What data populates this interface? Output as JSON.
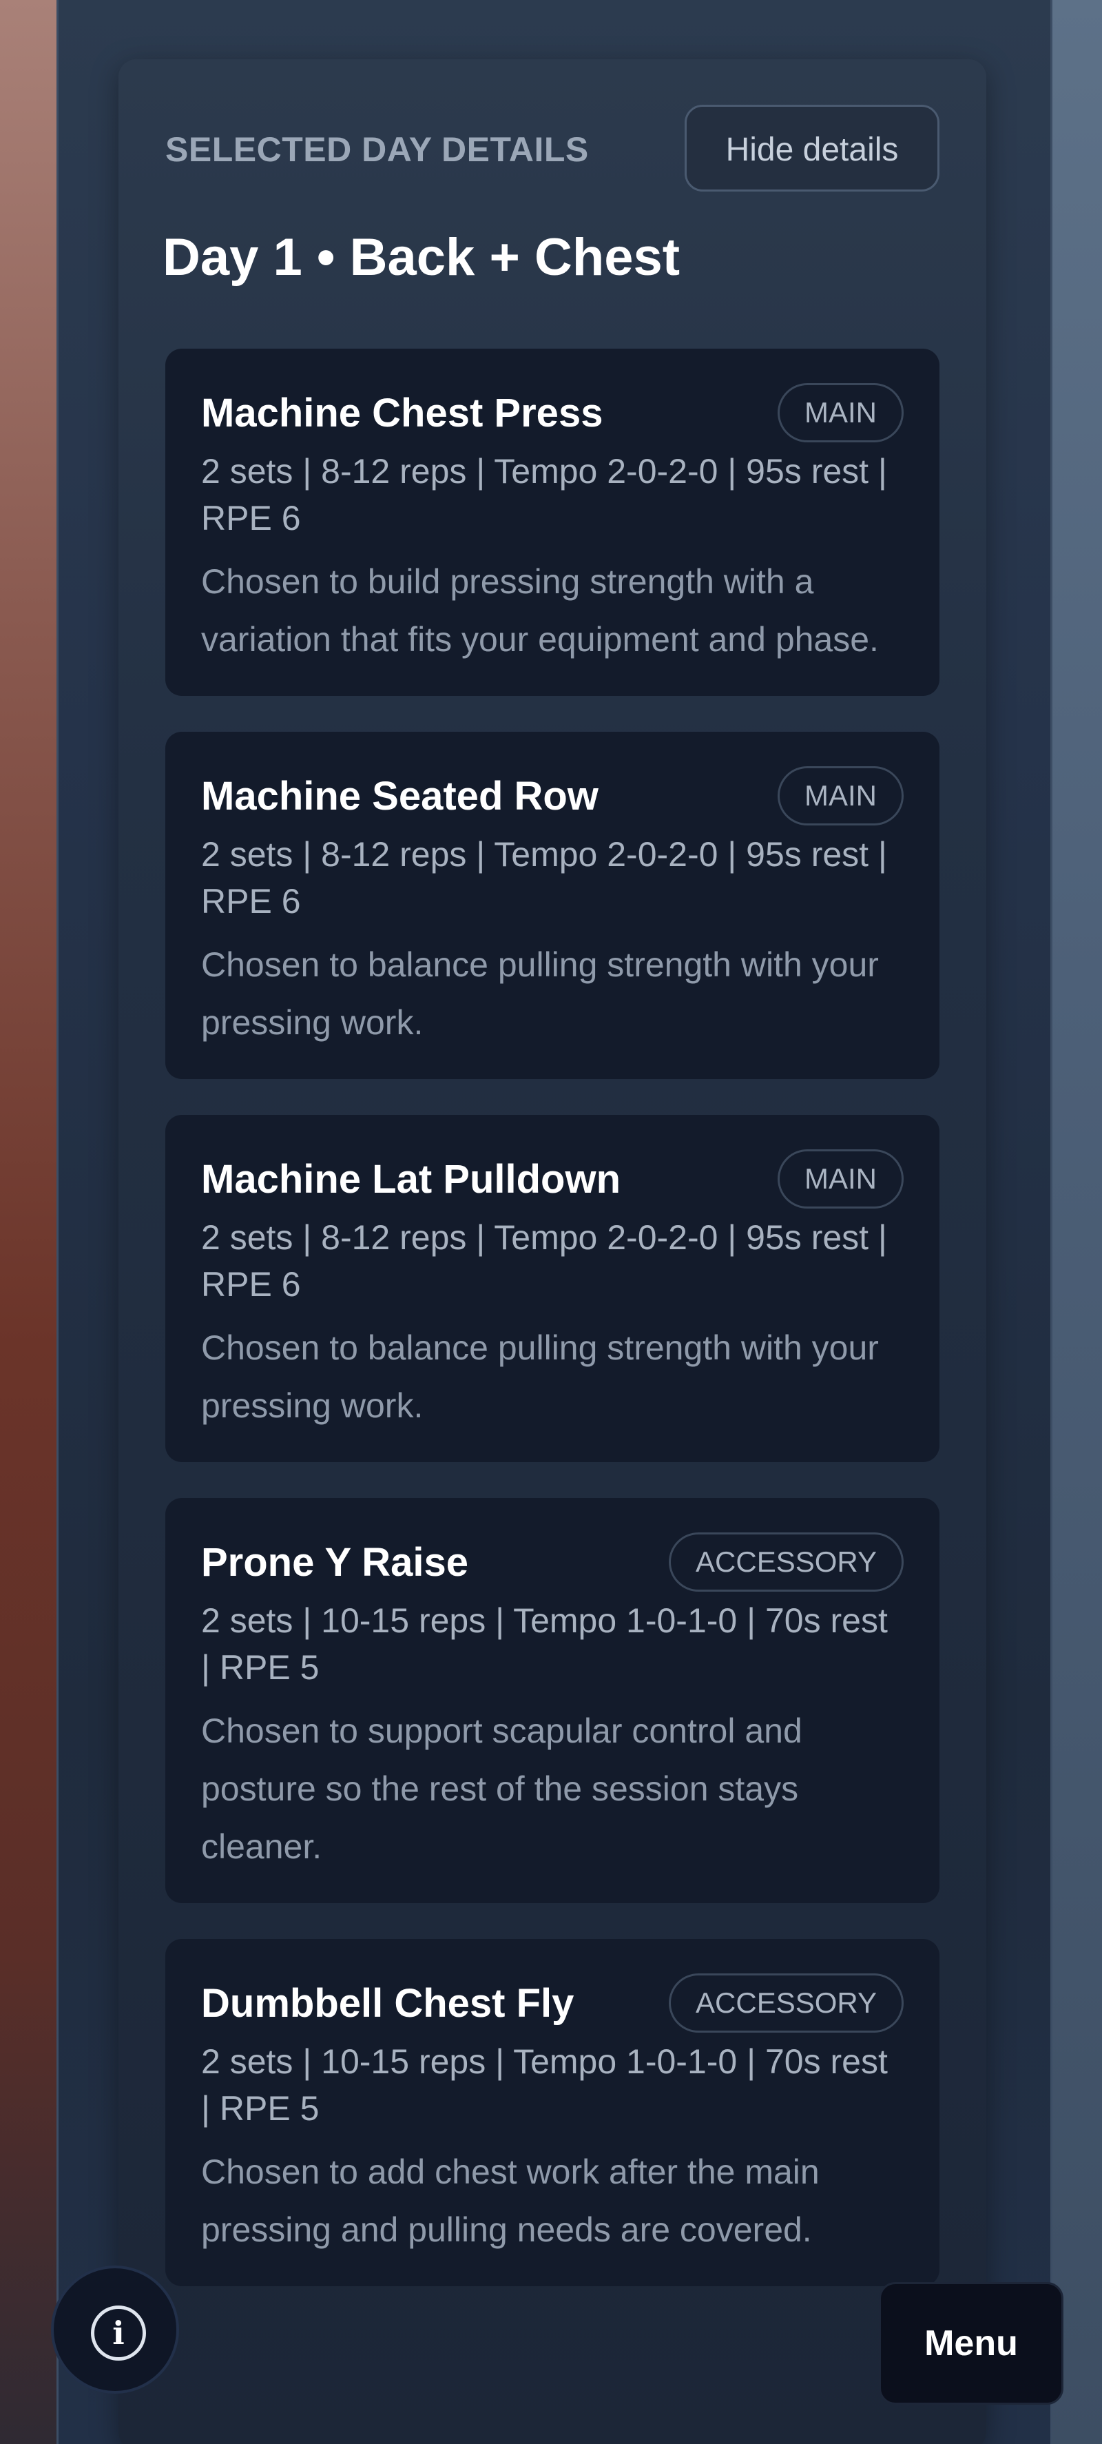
{
  "panel": {
    "section_label": "SELECTED DAY DETAILS",
    "hide_button": "Hide details",
    "day_title": "Day 1 • Back + Chest"
  },
  "exercises": [
    {
      "name": "Machine Chest Press",
      "badge": "MAIN",
      "meta": "2 sets | 8-12 reps | Tempo 2-0-2-0 | 95s rest | RPE 6",
      "desc": "Chosen to build pressing strength with a variation that fits your equipment and phase."
    },
    {
      "name": "Machine Seated Row",
      "badge": "MAIN",
      "meta": "2 sets | 8-12 reps | Tempo 2-0-2-0 | 95s rest | RPE 6",
      "desc": "Chosen to balance pulling strength with your pressing work."
    },
    {
      "name": "Machine Lat Pulldown",
      "badge": "MAIN",
      "meta": "2 sets | 8-12 reps | Tempo 2-0-2-0 | 95s rest | RPE 6",
      "desc": "Chosen to balance pulling strength with your pressing work."
    },
    {
      "name": "Prone Y Raise",
      "badge": "ACCESSORY",
      "meta": "2 sets | 10-15 reps | Tempo 1-0-1-0 | 70s rest | RPE 5",
      "desc": "Chosen to support scapular control and posture so the rest of the session stays cleaner."
    },
    {
      "name": "Dumbbell Chest Fly",
      "badge": "ACCESSORY",
      "meta": "2 sets | 10-15 reps | Tempo 1-0-1-0 | 70s rest | RPE 5",
      "desc": "Chosen to add chest work after the main pressing and pulling needs are covered."
    }
  ],
  "floating": {
    "info_icon": "i",
    "menu_label": "Menu"
  },
  "icons": {
    "info": "info-icon"
  }
}
